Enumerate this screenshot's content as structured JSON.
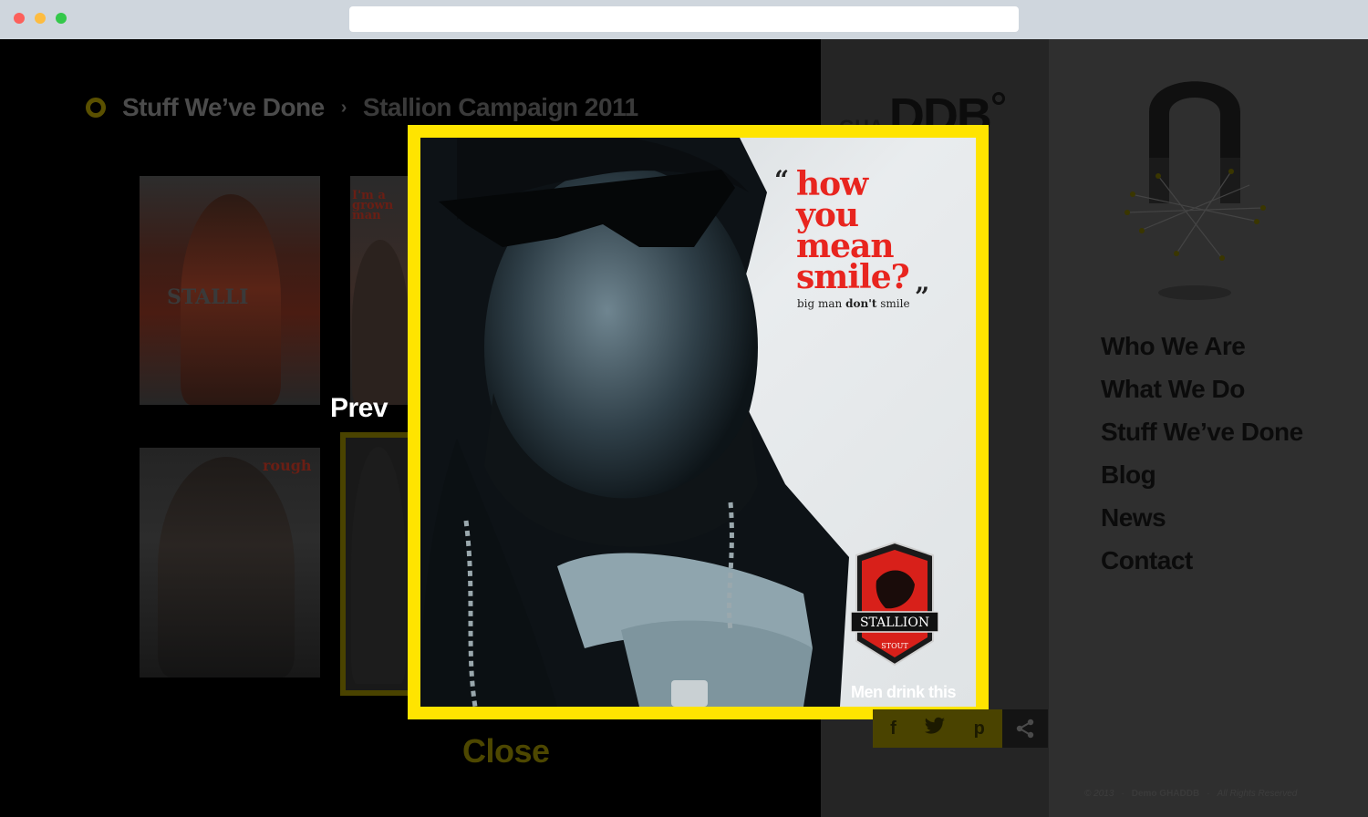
{
  "browser": {
    "url": ""
  },
  "breadcrumb": {
    "section": "Stuff We’ve Done",
    "separator": "›",
    "current": "Stallion Campaign 2011"
  },
  "logo": {
    "small": "GHA",
    "big": "DDB"
  },
  "thumbnails": [
    {
      "caption": "STALLI"
    },
    {
      "caption": "I'm a grown man"
    },
    {
      "caption": "rough"
    },
    {
      "caption": ""
    }
  ],
  "lightbox": {
    "headline": [
      "how",
      "you",
      "mean",
      "smile?"
    ],
    "subline_normal": "big man ",
    "subline_bold": "don't",
    "subline_end": " smile",
    "brand": "STALLION",
    "brand_sub": "STOUT",
    "tagline": "Men drink this"
  },
  "controls": {
    "prev": "Prev",
    "close": "Close"
  },
  "share": {
    "icons": [
      "facebook-icon",
      "twitter-icon",
      "pinterest-icon",
      "share-icon"
    ],
    "facebook": "f",
    "pinterest": "p"
  },
  "nav": {
    "items": [
      "Who We Are",
      "What We Do",
      "Stuff We’ve Done",
      "Blog",
      "News",
      "Contact"
    ]
  },
  "footer": {
    "year": "© 2013",
    "site": "Demo GHADDB",
    "rights": "All Rights Reserved",
    "sep": "·"
  },
  "colors": {
    "accent": "#ffe400",
    "headline": "#e8251f"
  }
}
